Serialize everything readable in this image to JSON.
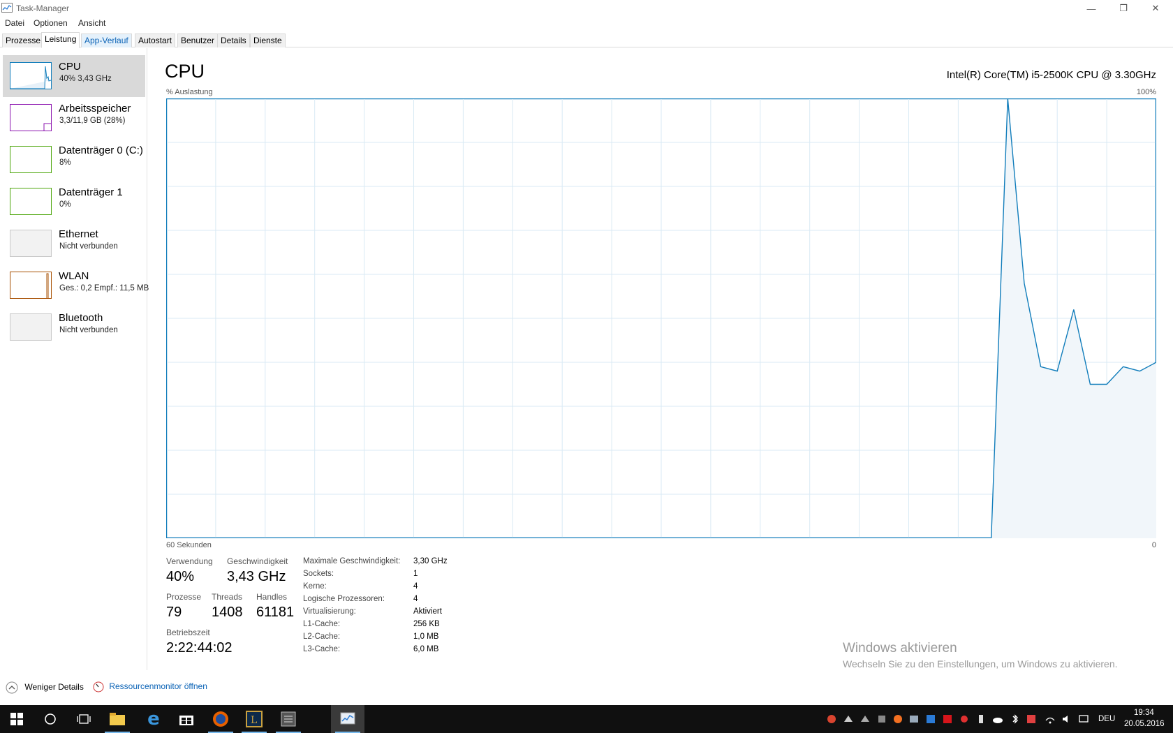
{
  "window": {
    "title": "Task-Manager",
    "buttons": {
      "minimize": "—",
      "restore": "❐",
      "close": "✕"
    }
  },
  "menu": [
    "Datei",
    "Optionen",
    "Ansicht"
  ],
  "tabs": [
    {
      "label": "Prozesse"
    },
    {
      "label": "Leistung"
    },
    {
      "label": "App-Verlauf"
    },
    {
      "label": "Autostart"
    },
    {
      "label": "Benutzer"
    },
    {
      "label": "Details"
    },
    {
      "label": "Dienste"
    }
  ],
  "sidebar": [
    {
      "name": "CPU",
      "sub": "40%  3,43 GHz",
      "color": "#117dbb"
    },
    {
      "name": "Arbeitsspeicher",
      "sub": "3,3/11,9 GB (28%)",
      "color": "#8b12ae"
    },
    {
      "name": "Datenträger 0 (C:)",
      "sub": "8%",
      "color": "#4da60c"
    },
    {
      "name": "Datenträger 1",
      "sub": "0%",
      "color": "#4da60c"
    },
    {
      "name": "Ethernet",
      "sub": "Nicht verbunden",
      "color": "#c8c8c8"
    },
    {
      "name": "WLAN",
      "sub": "Ges.: 0,2  Empf.: 11,5 MB",
      "color": "#a74f01"
    },
    {
      "name": "Bluetooth",
      "sub": "Nicht verbunden",
      "color": "#c8c8c8"
    }
  ],
  "main": {
    "title": "CPU",
    "model": "Intel(R) Core(TM) i5-2500K CPU @ 3.30GHz",
    "ylabel": "% Auslastung",
    "ymax_label": "100%",
    "xlabel_left": "60 Sekunden",
    "xlabel_right": "0"
  },
  "chart_data": {
    "type": "area",
    "ylabel": "% Auslastung",
    "xlabel": "60 Sekunden",
    "ylim": [
      0,
      100
    ],
    "x": [
      0,
      1,
      2,
      3,
      4,
      5,
      6,
      7,
      8,
      9,
      10,
      11,
      12,
      13,
      14,
      15,
      16,
      17,
      18,
      19,
      20,
      21,
      22,
      23,
      24,
      25,
      26,
      27,
      28,
      29,
      30,
      31,
      32,
      33,
      34,
      35,
      36,
      37,
      38,
      39,
      40,
      41,
      42,
      43,
      44,
      45,
      46,
      47,
      48,
      49,
      50,
      51,
      52,
      53,
      54,
      55,
      56,
      57,
      58,
      59
    ],
    "values": [
      null,
      null,
      null,
      null,
      null,
      null,
      null,
      null,
      null,
      null,
      null,
      null,
      null,
      null,
      null,
      null,
      null,
      null,
      null,
      null,
      null,
      null,
      null,
      null,
      null,
      null,
      null,
      null,
      null,
      null,
      null,
      null,
      null,
      null,
      null,
      null,
      null,
      null,
      null,
      null,
      null,
      null,
      null,
      null,
      null,
      null,
      null,
      null,
      null,
      null,
      0,
      100,
      58,
      39,
      38,
      52,
      35,
      35,
      39,
      38,
      40
    ],
    "color": "#117dbb",
    "grid": true
  },
  "stats": {
    "verwendung_label": "Verwendung",
    "verwendung": "40%",
    "geschwindigkeit_label": "Geschwindigkeit",
    "geschwindigkeit": "3,43 GHz",
    "prozesse_label": "Prozesse",
    "prozesse": "79",
    "threads_label": "Threads",
    "threads": "1408",
    "handles_label": "Handles",
    "handles": "61181",
    "betriebszeit_label": "Betriebszeit",
    "betriebszeit": "2:22:44:02"
  },
  "specs": [
    {
      "key": "Maximale Geschwindigkeit:",
      "value": "3,30 GHz"
    },
    {
      "key": "Sockets:",
      "value": "1"
    },
    {
      "key": "Kerne:",
      "value": "4"
    },
    {
      "key": "Logische Prozessoren:",
      "value": "4"
    },
    {
      "key": "Virtualisierung:",
      "value": "Aktiviert"
    },
    {
      "key": "L1-Cache:",
      "value": "256 KB"
    },
    {
      "key": "L2-Cache:",
      "value": "1,0 MB"
    },
    {
      "key": "L3-Cache:",
      "value": "6,0 MB"
    }
  ],
  "watermark": {
    "line1": "Windows aktivieren",
    "line2": "Wechseln Sie zu den Einstellungen, um Windows zu aktivieren."
  },
  "footer": {
    "fewer_details": "Weniger Details",
    "resource_monitor": "Ressourcenmonitor öffnen"
  },
  "taskbar": {
    "language": "DEU",
    "time": "19:34",
    "date": "20.05.2016",
    "apps": [
      "windows-start-icon",
      "search-circle-icon",
      "task-view-icon",
      "file-explorer-icon",
      "edge-icon",
      "store-icon",
      "firefox-icon",
      "league-icon",
      "notepad-icon",
      "task-manager-icon"
    ]
  }
}
